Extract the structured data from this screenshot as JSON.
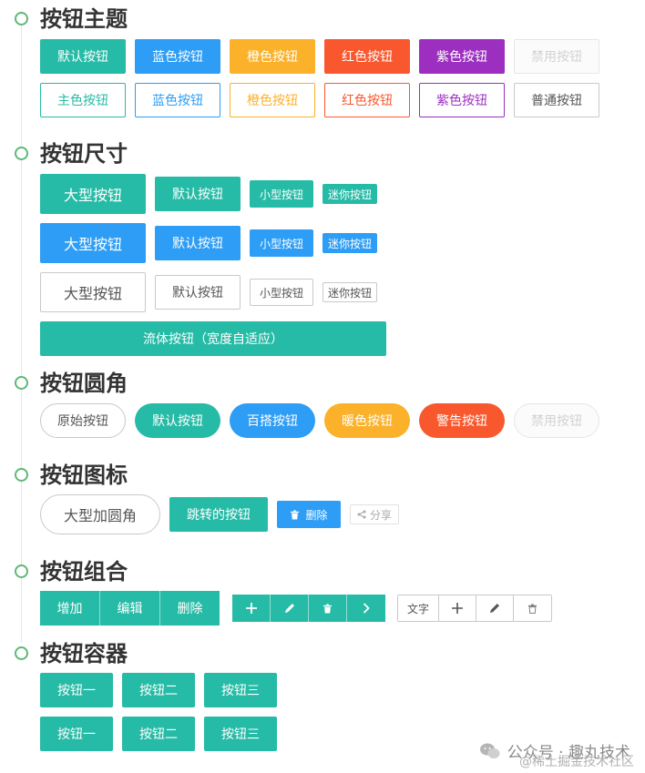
{
  "sections": {
    "theme": {
      "title": "按钮主题",
      "row1": [
        "默认按钮",
        "蓝色按钮",
        "橙色按钮",
        "红色按钮",
        "紫色按钮",
        "禁用按钮"
      ],
      "row2": [
        "主色按钮",
        "蓝色按钮",
        "橙色按钮",
        "红色按钮",
        "紫色按钮",
        "普通按钮"
      ]
    },
    "size": {
      "title": "按钮尺寸",
      "labels": {
        "large": "大型按钮",
        "default": "默认按钮",
        "small": "小型按钮",
        "mini": "迷你按钮"
      },
      "fluid": "流体按钮（宽度自适应）"
    },
    "radius": {
      "title": "按钮圆角",
      "buttons": [
        "原始按钮",
        "默认按钮",
        "百搭按钮",
        "暖色按钮",
        "警告按钮",
        "禁用按钮"
      ]
    },
    "icon": {
      "title": "按钮图标",
      "large_round": "大型加圆角",
      "jump": "跳转的按钮",
      "delete": "删除",
      "share": "分享"
    },
    "group": {
      "title": "按钮组合",
      "group1": [
        "增加",
        "编辑",
        "删除"
      ],
      "group3_text": "文字"
    },
    "container": {
      "title": "按钮容器",
      "row1": [
        "按钮一",
        "按钮二",
        "按钮三"
      ],
      "row2": [
        "按钮一",
        "按钮二",
        "按钮三"
      ]
    }
  },
  "watermark": {
    "main": "公众号 · 趣丸技术",
    "sub": "@稀土掘金技术社区"
  },
  "colors": {
    "teal": "#26bba6",
    "blue": "#2d9df5",
    "orange": "#fbb12a",
    "red": "#f9582e",
    "purple": "#9c2fbf",
    "timeline_dot": "#5fb878"
  },
  "icons": [
    "plus-icon",
    "pencil-icon",
    "trash-icon",
    "chevron-right-icon",
    "share-icon",
    "wechat-icon"
  ]
}
